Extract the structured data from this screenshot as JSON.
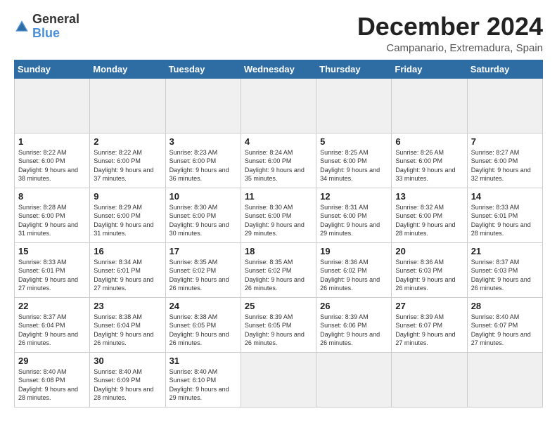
{
  "logo": {
    "general": "General",
    "blue": "Blue"
  },
  "title": "December 2024",
  "subtitle": "Campanario, Extremadura, Spain",
  "weekdays": [
    "Sunday",
    "Monday",
    "Tuesday",
    "Wednesday",
    "Thursday",
    "Friday",
    "Saturday"
  ],
  "cells": [
    {
      "day": "",
      "content": ""
    },
    {
      "day": "",
      "content": ""
    },
    {
      "day": "",
      "content": ""
    },
    {
      "day": "",
      "content": ""
    },
    {
      "day": "",
      "content": ""
    },
    {
      "day": "",
      "content": ""
    },
    {
      "day": "",
      "content": ""
    },
    {
      "day": "1",
      "content": "Sunrise: 8:22 AM\nSunset: 6:00 PM\nDaylight: 9 hours and 38 minutes."
    },
    {
      "day": "2",
      "content": "Sunrise: 8:22 AM\nSunset: 6:00 PM\nDaylight: 9 hours and 37 minutes."
    },
    {
      "day": "3",
      "content": "Sunrise: 8:23 AM\nSunset: 6:00 PM\nDaylight: 9 hours and 36 minutes."
    },
    {
      "day": "4",
      "content": "Sunrise: 8:24 AM\nSunset: 6:00 PM\nDaylight: 9 hours and 35 minutes."
    },
    {
      "day": "5",
      "content": "Sunrise: 8:25 AM\nSunset: 6:00 PM\nDaylight: 9 hours and 34 minutes."
    },
    {
      "day": "6",
      "content": "Sunrise: 8:26 AM\nSunset: 6:00 PM\nDaylight: 9 hours and 33 minutes."
    },
    {
      "day": "7",
      "content": "Sunrise: 8:27 AM\nSunset: 6:00 PM\nDaylight: 9 hours and 32 minutes."
    },
    {
      "day": "8",
      "content": "Sunrise: 8:28 AM\nSunset: 6:00 PM\nDaylight: 9 hours and 31 minutes."
    },
    {
      "day": "9",
      "content": "Sunrise: 8:29 AM\nSunset: 6:00 PM\nDaylight: 9 hours and 31 minutes."
    },
    {
      "day": "10",
      "content": "Sunrise: 8:30 AM\nSunset: 6:00 PM\nDaylight: 9 hours and 30 minutes."
    },
    {
      "day": "11",
      "content": "Sunrise: 8:30 AM\nSunset: 6:00 PM\nDaylight: 9 hours and 29 minutes."
    },
    {
      "day": "12",
      "content": "Sunrise: 8:31 AM\nSunset: 6:00 PM\nDaylight: 9 hours and 29 minutes."
    },
    {
      "day": "13",
      "content": "Sunrise: 8:32 AM\nSunset: 6:00 PM\nDaylight: 9 hours and 28 minutes."
    },
    {
      "day": "14",
      "content": "Sunrise: 8:33 AM\nSunset: 6:01 PM\nDaylight: 9 hours and 28 minutes."
    },
    {
      "day": "15",
      "content": "Sunrise: 8:33 AM\nSunset: 6:01 PM\nDaylight: 9 hours and 27 minutes."
    },
    {
      "day": "16",
      "content": "Sunrise: 8:34 AM\nSunset: 6:01 PM\nDaylight: 9 hours and 27 minutes."
    },
    {
      "day": "17",
      "content": "Sunrise: 8:35 AM\nSunset: 6:02 PM\nDaylight: 9 hours and 26 minutes."
    },
    {
      "day": "18",
      "content": "Sunrise: 8:35 AM\nSunset: 6:02 PM\nDaylight: 9 hours and 26 minutes."
    },
    {
      "day": "19",
      "content": "Sunrise: 8:36 AM\nSunset: 6:02 PM\nDaylight: 9 hours and 26 minutes."
    },
    {
      "day": "20",
      "content": "Sunrise: 8:36 AM\nSunset: 6:03 PM\nDaylight: 9 hours and 26 minutes."
    },
    {
      "day": "21",
      "content": "Sunrise: 8:37 AM\nSunset: 6:03 PM\nDaylight: 9 hours and 26 minutes."
    },
    {
      "day": "22",
      "content": "Sunrise: 8:37 AM\nSunset: 6:04 PM\nDaylight: 9 hours and 26 minutes."
    },
    {
      "day": "23",
      "content": "Sunrise: 8:38 AM\nSunset: 6:04 PM\nDaylight: 9 hours and 26 minutes."
    },
    {
      "day": "24",
      "content": "Sunrise: 8:38 AM\nSunset: 6:05 PM\nDaylight: 9 hours and 26 minutes."
    },
    {
      "day": "25",
      "content": "Sunrise: 8:39 AM\nSunset: 6:05 PM\nDaylight: 9 hours and 26 minutes."
    },
    {
      "day": "26",
      "content": "Sunrise: 8:39 AM\nSunset: 6:06 PM\nDaylight: 9 hours and 26 minutes."
    },
    {
      "day": "27",
      "content": "Sunrise: 8:39 AM\nSunset: 6:07 PM\nDaylight: 9 hours and 27 minutes."
    },
    {
      "day": "28",
      "content": "Sunrise: 8:40 AM\nSunset: 6:07 PM\nDaylight: 9 hours and 27 minutes."
    },
    {
      "day": "29",
      "content": "Sunrise: 8:40 AM\nSunset: 6:08 PM\nDaylight: 9 hours and 28 minutes."
    },
    {
      "day": "30",
      "content": "Sunrise: 8:40 AM\nSunset: 6:09 PM\nDaylight: 9 hours and 28 minutes."
    },
    {
      "day": "31",
      "content": "Sunrise: 8:40 AM\nSunset: 6:10 PM\nDaylight: 9 hours and 29 minutes."
    },
    {
      "day": "",
      "content": ""
    },
    {
      "day": "",
      "content": ""
    },
    {
      "day": "",
      "content": ""
    },
    {
      "day": "",
      "content": ""
    }
  ]
}
